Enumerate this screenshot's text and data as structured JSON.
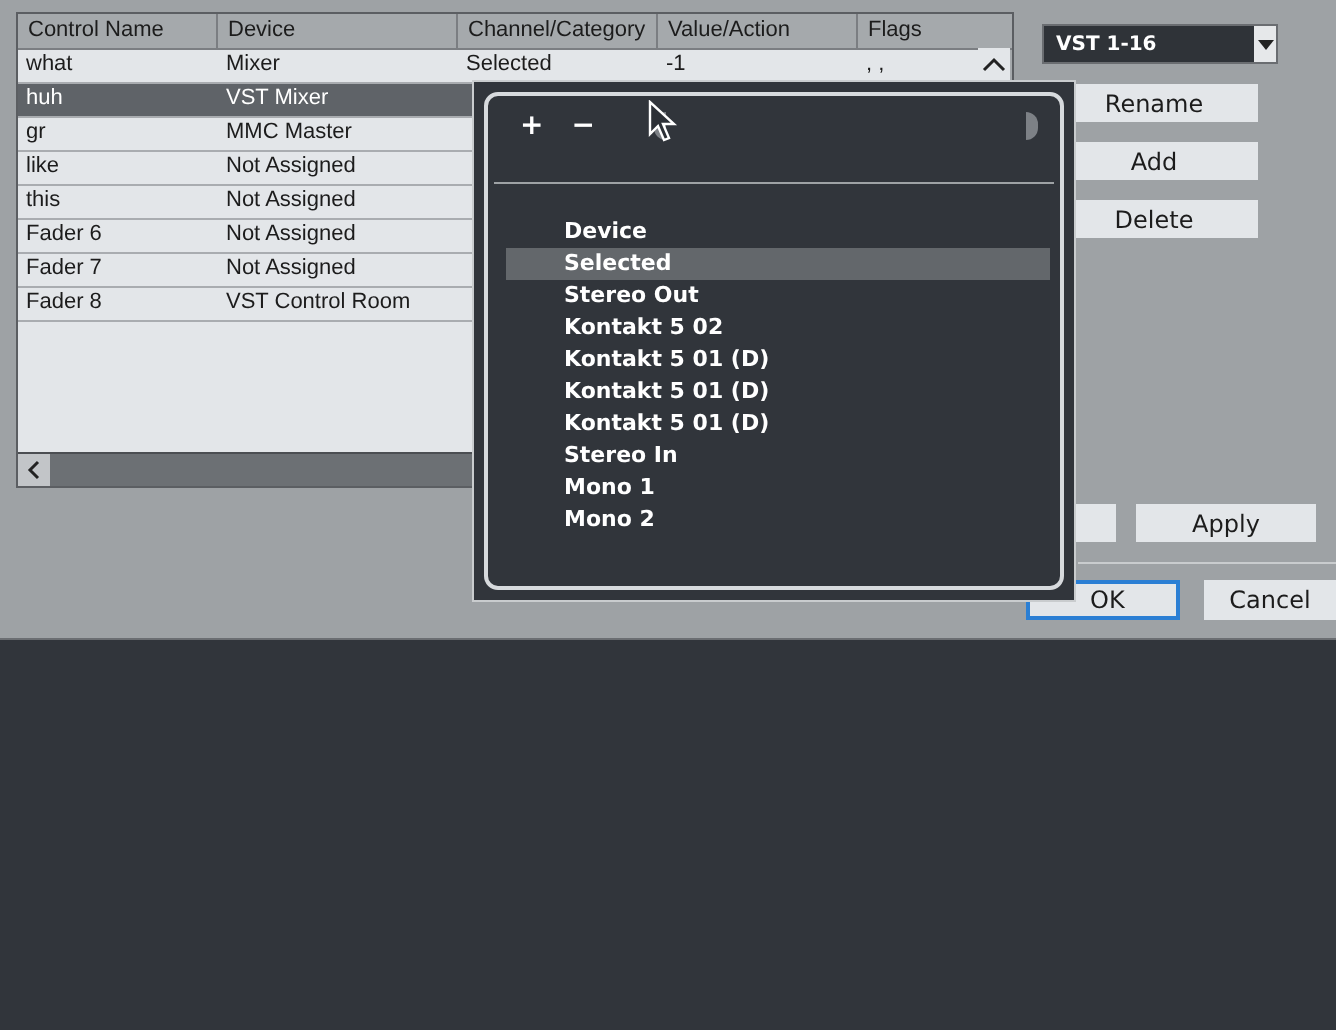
{
  "table": {
    "columns": [
      "Control Name",
      "Device",
      "Channel/Category",
      "Value/Action",
      "Flags"
    ],
    "rows": [
      {
        "cells": [
          "what",
          "Mixer",
          "Selected",
          "-1",
          ", ,"
        ],
        "selected": false
      },
      {
        "cells": [
          "huh",
          "VST Mixer"
        ],
        "selected": true
      },
      {
        "cells": [
          "gr",
          "MMC Master"
        ],
        "selected": false
      },
      {
        "cells": [
          "like",
          "Not Assigned"
        ],
        "selected": false
      },
      {
        "cells": [
          "this",
          "Not Assigned"
        ],
        "selected": false
      },
      {
        "cells": [
          "Fader 6",
          "Not Assigned"
        ],
        "selected": false
      },
      {
        "cells": [
          "Fader 7",
          "Not Assigned"
        ],
        "selected": false
      },
      {
        "cells": [
          "Fader 8",
          "VST Control Room"
        ],
        "selected": false
      }
    ]
  },
  "dropdown": {
    "value": "VST 1-16"
  },
  "side_buttons": [
    {
      "label": "Rename"
    },
    {
      "label": "Add"
    },
    {
      "label": "Delete"
    }
  ],
  "footer_buttons": [
    {
      "kind": "blank"
    },
    {
      "kind": "text",
      "label": "Apply"
    }
  ],
  "dialog_buttons": [
    {
      "label": "OK",
      "default": true
    },
    {
      "label": "Cancel",
      "default": false
    }
  ],
  "popup": {
    "plus": "+",
    "minus": "−",
    "items": [
      {
        "label": "Device",
        "selected": false
      },
      {
        "label": "Selected",
        "selected": true
      },
      {
        "label": "Stereo Out",
        "selected": false
      },
      {
        "label": "Kontakt 5 02",
        "selected": false
      },
      {
        "label": "Kontakt 5 01 (D)",
        "selected": false
      },
      {
        "label": "Kontakt 5 01 (D)",
        "selected": false
      },
      {
        "label": "Kontakt 5 01 (D)",
        "selected": false
      },
      {
        "label": "Stereo In",
        "selected": false
      },
      {
        "label": "Mono 1",
        "selected": false
      },
      {
        "label": "Mono 2",
        "selected": false
      }
    ]
  }
}
